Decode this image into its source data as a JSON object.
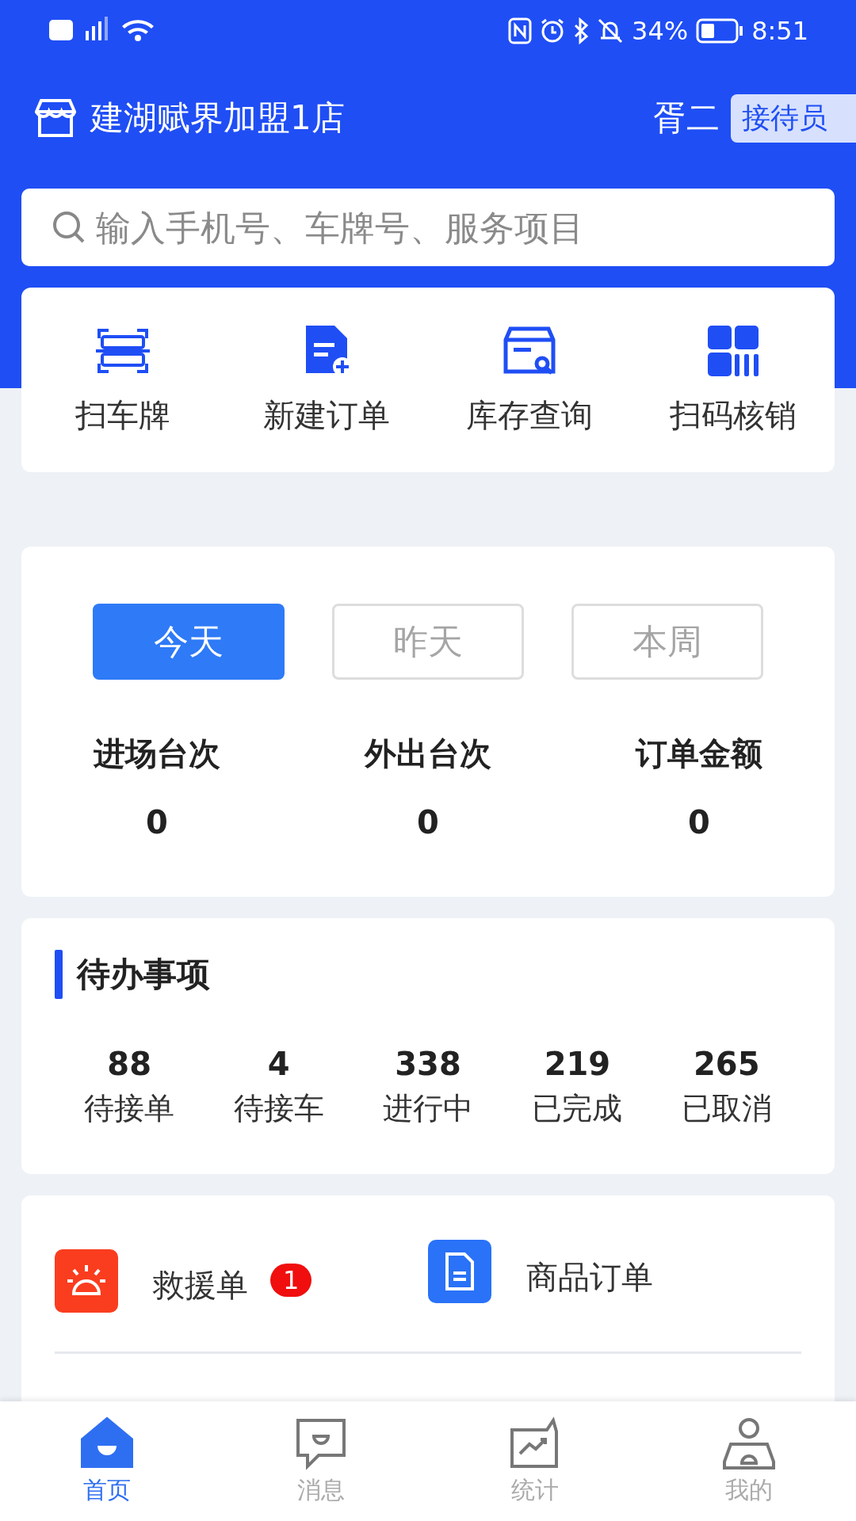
{
  "status_bar": {
    "battery": "34%",
    "time": "8:51"
  },
  "header": {
    "store_name": "建湖赋界加盟1店",
    "user_name": "胥二",
    "role": "接待员"
  },
  "search": {
    "placeholder": "输入手机号、车牌号、服务项目"
  },
  "quick_actions": [
    {
      "kind": "scan",
      "label": "扫车牌"
    },
    {
      "kind": "new",
      "label": "新建订单"
    },
    {
      "kind": "stock",
      "label": "库存查询"
    },
    {
      "kind": "code",
      "label": "扫码核销"
    }
  ],
  "period_tabs": [
    {
      "label": "今天",
      "selected": true
    },
    {
      "label": "昨天",
      "selected": false
    },
    {
      "label": "本周",
      "selected": false
    }
  ],
  "stats": [
    {
      "label": "进场台次",
      "value": "0"
    },
    {
      "label": "外出台次",
      "value": "0"
    },
    {
      "label": "订单金额",
      "value": "0"
    }
  ],
  "todo": {
    "title": "待办事项",
    "items": [
      {
        "count": "88",
        "label": "待接单"
      },
      {
        "count": "4",
        "label": "待接车"
      },
      {
        "count": "338",
        "label": "进行中"
      },
      {
        "count": "219",
        "label": "已完成"
      },
      {
        "count": "265",
        "label": "已取消"
      }
    ]
  },
  "entries": [
    {
      "kind": "rescue",
      "label": "救援单",
      "badge": "1",
      "color": "#fa3d1f"
    },
    {
      "kind": "goods",
      "label": "商品订单",
      "color": "#2a72f8"
    }
  ],
  "tab_bar": [
    {
      "kind": "home",
      "label": "首页",
      "selected": true
    },
    {
      "kind": "message",
      "label": "消息",
      "selected": false
    },
    {
      "kind": "stats",
      "label": "统计",
      "selected": false
    },
    {
      "kind": "me",
      "label": "我的",
      "selected": false
    }
  ]
}
